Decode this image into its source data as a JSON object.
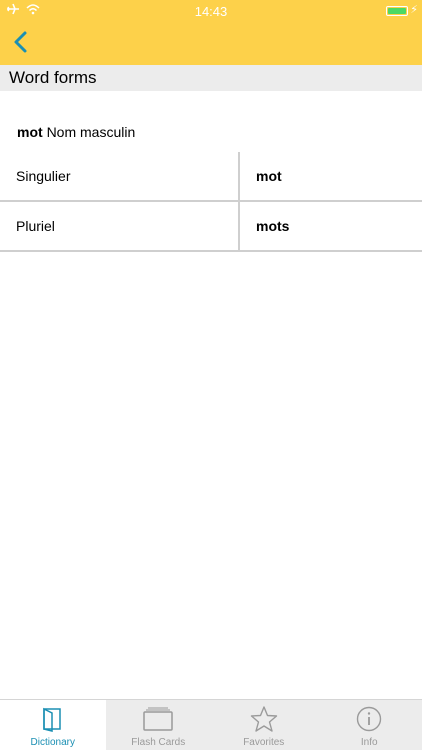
{
  "status": {
    "time": "14:43"
  },
  "colors": {
    "accent": "#fdd14a",
    "tab_active": "#1b8fb3",
    "battery": "#4cd964"
  },
  "section": {
    "title": "Word forms"
  },
  "entry": {
    "word": "mot",
    "pos": "Nom masculin"
  },
  "forms": [
    {
      "label": "Singulier",
      "value": "mot"
    },
    {
      "label": "Pluriel",
      "value": "mots"
    }
  ],
  "tabs": [
    {
      "label": "Dictionary",
      "icon": "book-icon",
      "active": true
    },
    {
      "label": "Flash Cards",
      "icon": "cards-icon",
      "active": false
    },
    {
      "label": "Favorites",
      "icon": "star-icon",
      "active": false
    },
    {
      "label": "Info",
      "icon": "info-icon",
      "active": false
    }
  ]
}
